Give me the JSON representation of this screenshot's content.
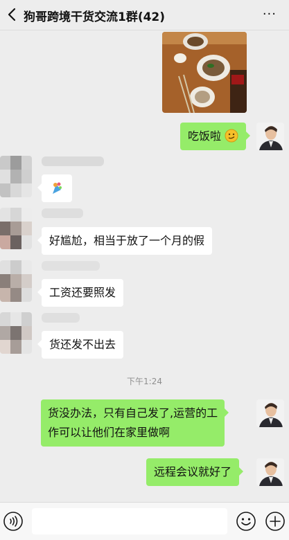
{
  "header": {
    "title": "狗哥跨境干货交流1群(42)",
    "more": "···"
  },
  "messages": {
    "m1_text": "吃饭啦",
    "m3_text": "好尴尬，相当于放了一个月的假",
    "m4_text": "工资还要照发",
    "m5_text": "货还发不出去",
    "time": "下午1:24",
    "m6_line1": "货没办法，只有自己发了,运营的工",
    "m6_line2": "作可以让他们在家里做啊",
    "m7_text": "远程会议就好了"
  },
  "colors": {
    "outgoing_bubble": "#95ec69",
    "incoming_bubble": "#ffffff",
    "background": "#ededed"
  },
  "icons": {
    "back": "chevron-left-icon",
    "more": "ellipsis-icon",
    "voice": "voice-icon",
    "emoji": "emoji-icon",
    "plus": "plus-icon"
  }
}
